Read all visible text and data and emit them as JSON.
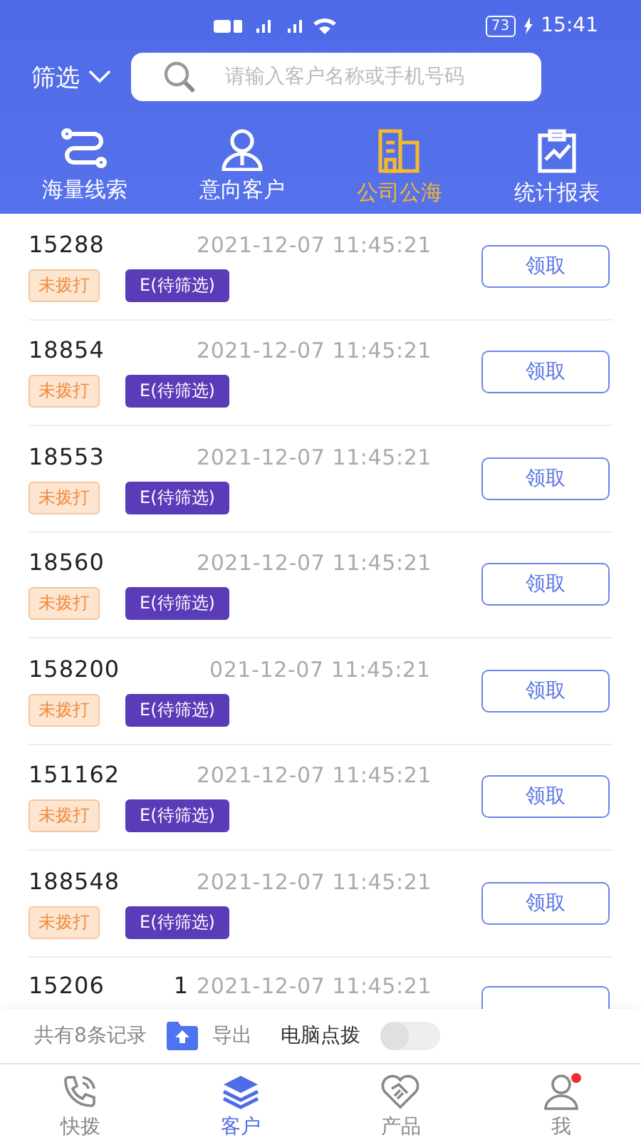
{
  "status_bar": {
    "battery": "73",
    "time": "15:41"
  },
  "header": {
    "filter": "筛选",
    "search": {
      "placeholder": "请输入客户名称或手机号码"
    }
  },
  "tabs": [
    {
      "label": "海量线索",
      "selected": false
    },
    {
      "label": "意向客户",
      "selected": false
    },
    {
      "label": "公司公海",
      "selected": true
    },
    {
      "label": "统计报表",
      "selected": false
    }
  ],
  "rows": [
    {
      "phone": "15288",
      "time": "2021-12-07 11:45:21",
      "call_status": "未拨打",
      "grade": "E(待筛选)",
      "action": "领取"
    },
    {
      "phone": "18854",
      "time": "2021-12-07 11:45:21",
      "call_status": "未拨打",
      "grade": "E(待筛选)",
      "action": "领取"
    },
    {
      "phone": "18553",
      "time": "2021-12-07 11:45:21",
      "call_status": "未拨打",
      "grade": "E(待筛选)",
      "action": "领取"
    },
    {
      "phone": "18560",
      "time": "2021-12-07 11:45:21",
      "call_status": "未拨打",
      "grade": "E(待筛选)",
      "action": "领取"
    },
    {
      "phone": "158200",
      "time": "021-12-07 11:45:21",
      "call_status": "未拨打",
      "grade": "E(待筛选)",
      "action": "领取"
    },
    {
      "phone": "151162",
      "time": "2021-12-07 11:45:21",
      "call_status": "未拨打",
      "grade": "E(待筛选)",
      "action": "领取"
    },
    {
      "phone": "188548",
      "time": "2021-12-07 11:45:21",
      "call_status": "未拨打",
      "grade": "E(待筛选)",
      "action": "领取"
    },
    {
      "phone": "15206",
      "phone_suffix": "1",
      "time": "2021-12-07 11:45:21"
    }
  ],
  "footer": {
    "count": "共有8条记录",
    "export": "导出",
    "pc_dial": "电脑点拨",
    "pc_dial_on": false
  },
  "nav": [
    {
      "label": "快拨",
      "selected": false,
      "badge": false
    },
    {
      "label": "客户",
      "selected": true,
      "badge": false
    },
    {
      "label": "产品",
      "selected": false,
      "badge": false
    },
    {
      "label": "我",
      "selected": false,
      "badge": true
    }
  ]
}
